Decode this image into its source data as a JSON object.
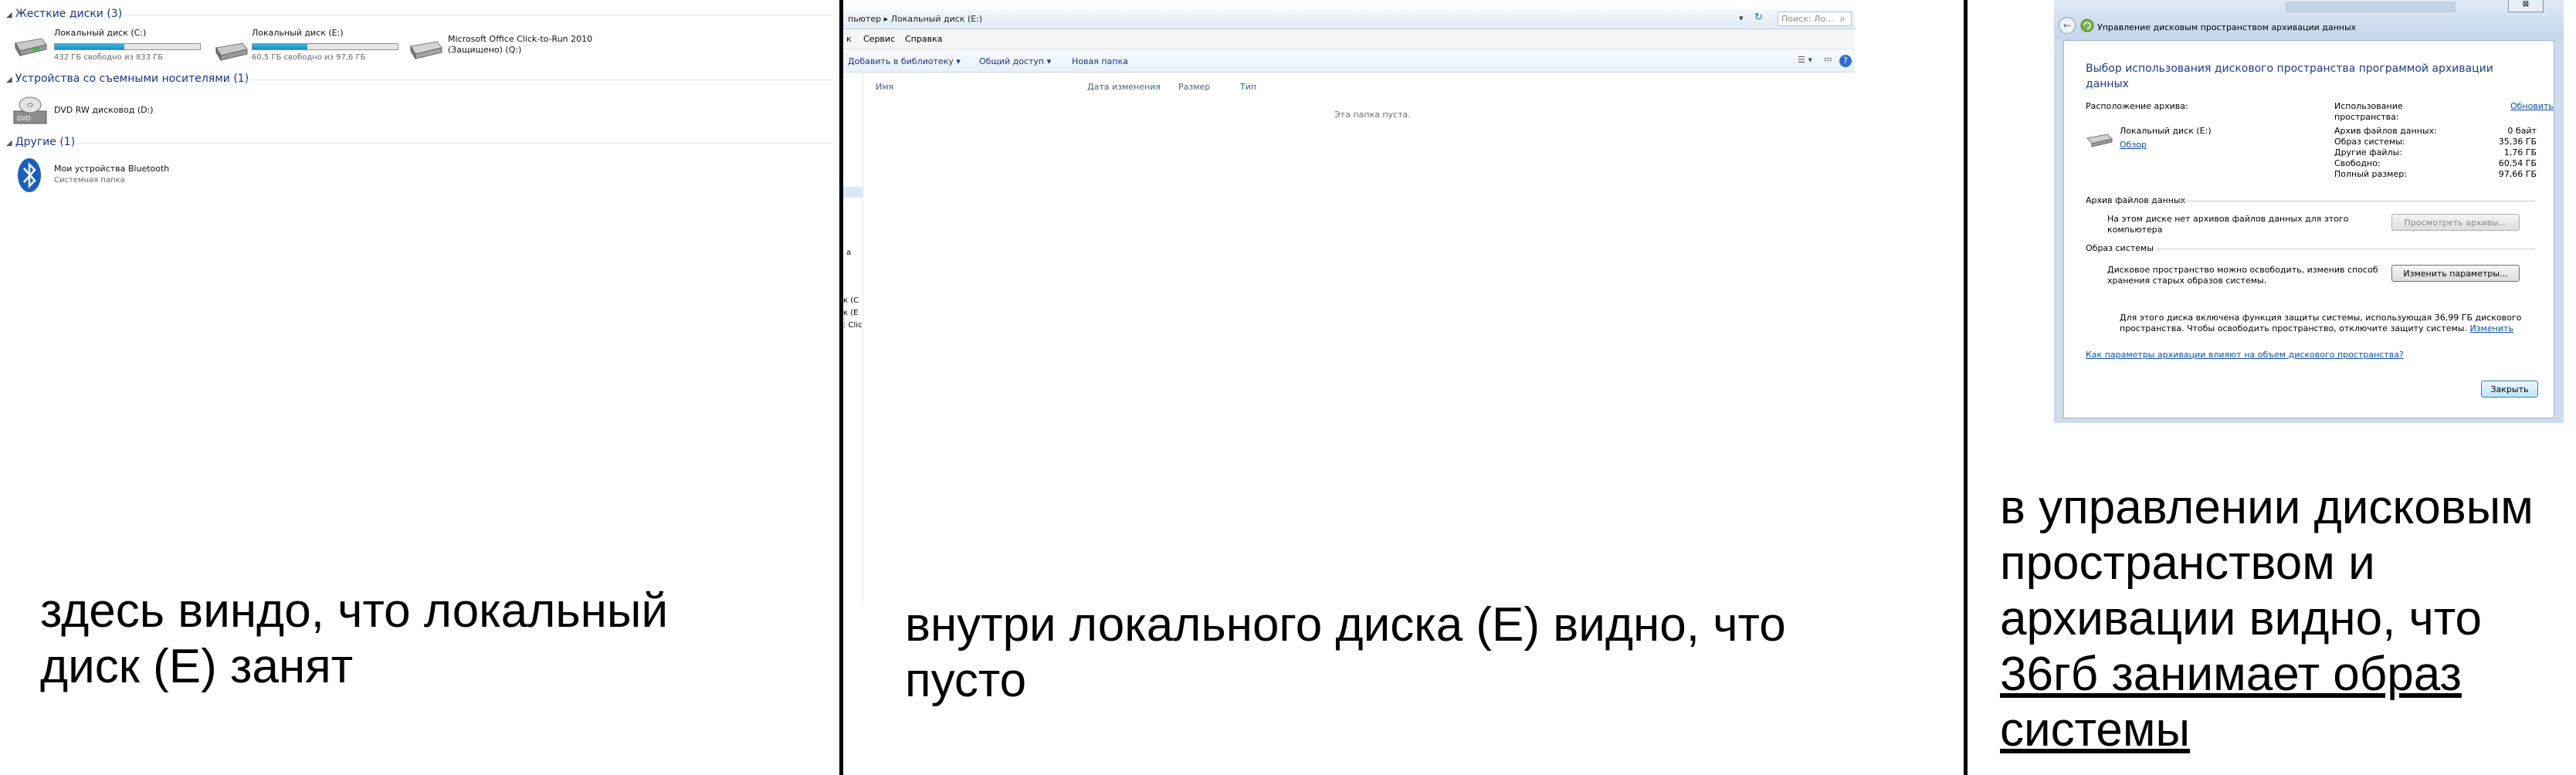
{
  "panel1": {
    "groups": {
      "hard_disks": "Жесткие диски (3)",
      "removable": "Устройства со съемными носителями (1)",
      "other": "Другие (1)"
    },
    "drives": [
      {
        "name": "Локальный диск (C:)",
        "free": "432 ГБ свободно из 833 ГБ",
        "used_fraction": 0.48
      },
      {
        "name": "Локальный диск (E:)",
        "free": "60,5 ГБ свободно из 97,6 ГБ",
        "used_fraction": 0.38
      },
      {
        "name": "Microsoft Office Click-to-Run 2010",
        "sub": "(Защищено) (Q:)"
      }
    ],
    "dvd": "DVD RW дисковод (D:)",
    "bluetooth": {
      "name": "Мои устройства Bluetooth",
      "sub": "Системная папка"
    },
    "caption_l1": "здесь виндо, что локальный",
    "caption_l2": "диск (Е) занят"
  },
  "panel2": {
    "breadcrumb": "пьютер  ▸  Локальный диск (E:)",
    "search_placeholder": "Поиск: Ло...",
    "menu": [
      "к",
      "Сервис",
      "Справка"
    ],
    "toolbar": [
      "Добавить в библиотеку ▾",
      "Общий доступ ▾",
      "Новая папка"
    ],
    "columns": [
      "Имя",
      "Дата изменения",
      "Размер",
      "Тип"
    ],
    "empty_text": "Эта папка пуста.",
    "nav_fragments": [
      "a",
      "к (С",
      "к (E",
      ": Clic"
    ],
    "caption_l1": "внутри локального диска (Е) видно, что",
    "caption_l2": "пусто"
  },
  "panel3": {
    "title": "Управление дисковым пространством архивации данных",
    "heading": "Выбор использования дискового пространства программой архивации данных",
    "location_label": "Расположение архива:",
    "usage_label_1": "Использование",
    "usage_label_2": "пространства:",
    "refresh": "Обновить",
    "disk_name": "Локальный диск (E:)",
    "browse": "Обзор",
    "usage": [
      {
        "label": "Архив файлов данных:",
        "value": "0 байт"
      },
      {
        "label": "Образ системы:",
        "value": "35,36 ГБ"
      },
      {
        "label": "Другие файлы:",
        "value": "1,76 ГБ"
      },
      {
        "label": "Свободно:",
        "value": "60,54 ГБ"
      },
      {
        "label": "Полный размер:",
        "value": "97,66 ГБ"
      }
    ],
    "data_archive_title": "Архив файлов данных",
    "data_archive_text_1": "На этом диске нет архивов файлов данных для этого",
    "data_archive_text_2": "компьютера",
    "view_archives_btn": "Просмотреть архивы...",
    "system_image_title": "Образ системы",
    "system_image_text_1": "Дисковое пространство можно освободить, изменив способ",
    "system_image_text_2": "хранения старых образов системы.",
    "change_params_btn": "Изменить параметры...",
    "protection_text_1": "Для этого диска включена функция защиты системы, использующая 36,99 ГБ дискового",
    "protection_text_2": "пространства. Чтобы освободить пространство, отключите защиту системы.",
    "change_link": "Изменить",
    "help_link": "Как параметры архивации влияют на объем дискового пространства?",
    "close_btn": "Закрыть",
    "caption_l1": "в управлении дисковым",
    "caption_l2": "пространством и",
    "caption_l3": "архивации видно, что",
    "caption_l4": "36гб занимает образ ",
    "caption_l5": "системы"
  },
  "colors": {
    "group_header": "#1e3287",
    "link": "#0a4bb1",
    "bar_fill": "#1b8ec4"
  }
}
